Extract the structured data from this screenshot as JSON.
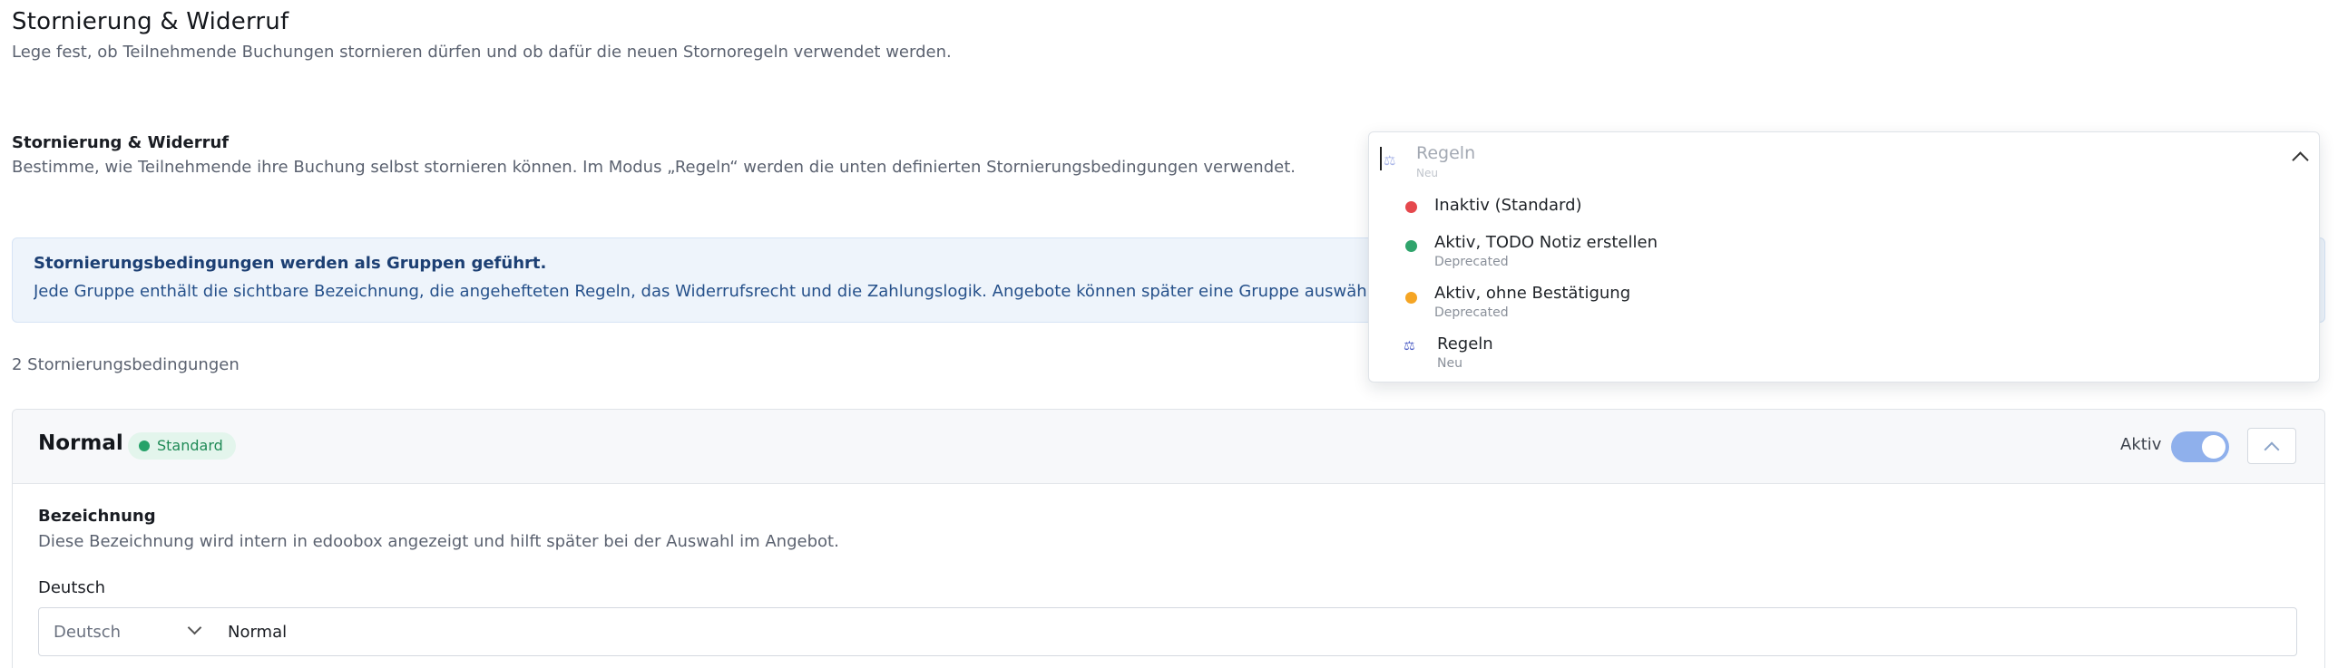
{
  "page": {
    "title": "Stornierung & Widerruf",
    "subtitle": "Lege fest, ob Teilnehmende Buchungen stornieren dürfen und ob dafür die neuen Stornoregeln verwendet werden."
  },
  "field": {
    "title": "Stornierung & Widerruf",
    "description": "Bestimme, wie Teilnehmende ihre Buchung selbst stornieren können. Im Modus „Regeln“ werden die unten definierten Stornierungsbedingungen verwendet."
  },
  "info": {
    "title": "Stornierungsbedingungen werden als Gruppen geführt.",
    "text": "Jede Gruppe enthält die sichtbare Bezeichnung, die angehefteten Regeln, das Widerrufsrecht und die Zahlungslogik. Angebote können später eine Gruppe auswählen."
  },
  "count_label": "2 Stornierungsbedingungen",
  "group": {
    "name": "Normal",
    "badge": "Standard",
    "active_label": "Aktiv",
    "active": true,
    "bez_title": "Bezeichnung",
    "bez_desc": "Diese Bezeichnung wird intern in edoobox angezeigt und hilft später bei der Auswahl im Angebot.",
    "lang_label": "Deutsch",
    "lang_select": "Deutsch",
    "lang_value": "Normal"
  },
  "dropdown": {
    "selected_label": "Regeln",
    "selected_sub": "Neu",
    "options": [
      {
        "label": "Inaktiv (Standard)",
        "sub": "",
        "color": "#e5484d"
      },
      {
        "label": "Aktiv, TODO Notiz erstellen",
        "sub": "Deprecated",
        "color": "#30a46c"
      },
      {
        "label": "Aktiv, ohne Bestätigung",
        "sub": "Deprecated",
        "color": "#f5a524"
      },
      {
        "label": "Regeln",
        "sub": "Neu",
        "icon": "scale-icon"
      }
    ]
  },
  "colors": {
    "accent": "#8fb0ec",
    "badge_bg": "#e3f5ec",
    "badge_text": "#1f8a56",
    "info_bg": "#eef4fb"
  }
}
